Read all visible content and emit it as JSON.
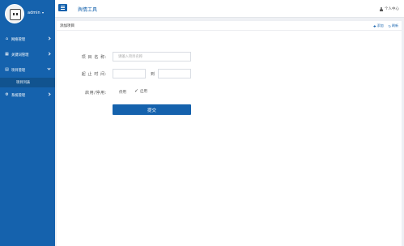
{
  "sidebar": {
    "username": "admin",
    "items": [
      {
        "label": "网络管理",
        "icon": "home-icon"
      },
      {
        "label": "关键词管理",
        "icon": "grid-icon"
      },
      {
        "label": "项目管理",
        "icon": "document-icon",
        "open": true
      },
      {
        "label": "系统管理",
        "icon": "gear-icon"
      }
    ],
    "submenu": {
      "label": "项目列表"
    }
  },
  "topbar": {
    "app_title": "舆情工具",
    "user_center": "个人中心"
  },
  "panel": {
    "title": "添加项目",
    "actions": {
      "add": "添加",
      "refresh": "刷新"
    }
  },
  "form": {
    "name_label": "项 目 名 称:",
    "name_placeholder": "请输入项目名称",
    "time_label": "起 止 时 间:",
    "to_label": "到",
    "status_label": "启用/停用:",
    "status_off": "停用",
    "status_on": "启用",
    "status_selected": "启用",
    "submit_label": "提交"
  },
  "colors": {
    "brand": "#1562ad",
    "sidebar_sub": "#11538f",
    "page_bg": "#eef0f4"
  }
}
